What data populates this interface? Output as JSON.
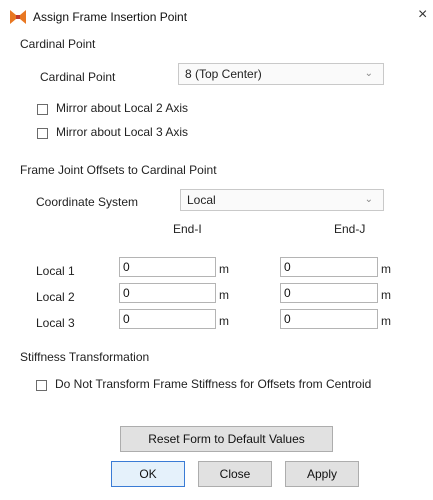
{
  "window": {
    "title": "Assign Frame Insertion Point",
    "close_glyph": "×"
  },
  "cardinal": {
    "section_label": "Cardinal Point",
    "field_label": "Cardinal Point",
    "selected": "8  (Top Center)",
    "mirror2_label": "Mirror about Local 2 Axis",
    "mirror3_label": "Mirror about Local 3 Axis",
    "mirror2_checked": false,
    "mirror3_checked": false
  },
  "offsets": {
    "section_label": "Frame Joint Offsets to Cardinal Point",
    "coord_label": "Coordinate System",
    "coord_selected": "Local",
    "end_i": "End-I",
    "end_j": "End-J",
    "unit": "m",
    "rows": [
      {
        "label": "Local 1",
        "end_i": "0",
        "end_j": "0"
      },
      {
        "label": "Local 2",
        "end_i": "0",
        "end_j": "0"
      },
      {
        "label": "Local 3",
        "end_i": "0",
        "end_j": "0"
      }
    ]
  },
  "stiffness": {
    "section_label": "Stiffness Transformation",
    "check_label": "Do Not Transform Frame Stiffness for Offsets from Centroid",
    "checked": false
  },
  "buttons": {
    "reset": "Reset Form to Default Values",
    "ok": "OK",
    "close": "Close",
    "apply": "Apply"
  },
  "icons": {
    "app": "frame-insertion-icon",
    "dropdown": "chevron-down-icon",
    "close": "close-icon"
  }
}
